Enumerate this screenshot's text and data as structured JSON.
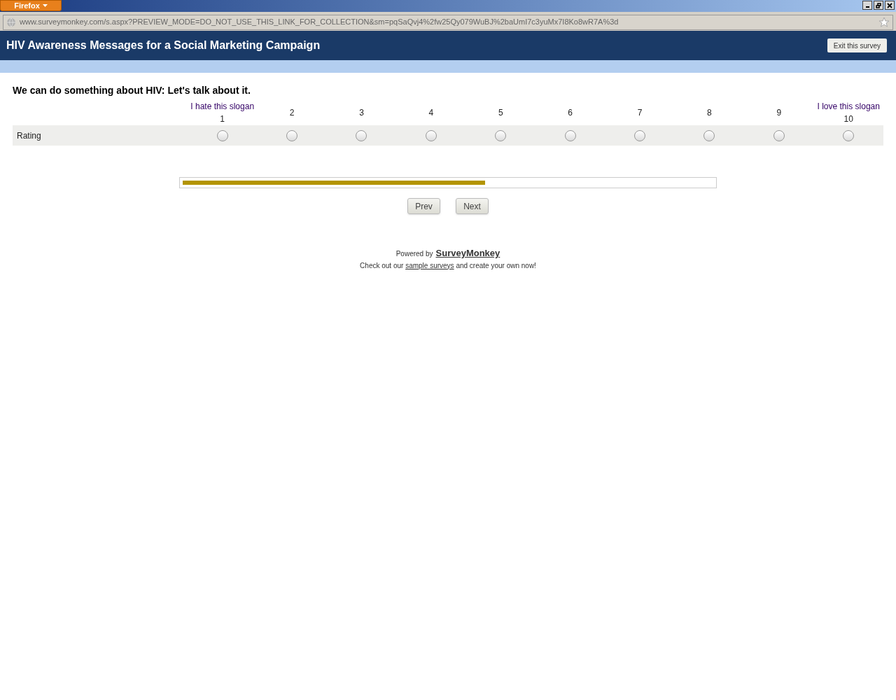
{
  "browser": {
    "menu_button": "Firefox",
    "url": "www.surveymonkey.com/s.aspx?PREVIEW_MODE=DO_NOT_USE_THIS_LINK_FOR_COLLECTION&sm=pqSaQvj4%2fw25Qy079WuBJ%2baUmI7c3yuMx7I8Ko8wR7A%3d"
  },
  "header": {
    "title": "HIV Awareness Messages for a Social Marketing Campaign",
    "exit_button": "Exit this survey"
  },
  "question": {
    "text": "We can do something about HIV: Let's talk about it.",
    "columns": [
      {
        "caption": "I hate this slogan",
        "number": "1"
      },
      {
        "number": "2"
      },
      {
        "number": "3"
      },
      {
        "number": "4"
      },
      {
        "number": "5"
      },
      {
        "number": "6"
      },
      {
        "number": "7"
      },
      {
        "number": "8"
      },
      {
        "number": "9"
      },
      {
        "caption": "I love this slogan",
        "number": "10"
      }
    ],
    "rows": [
      {
        "label": "Rating",
        "choices": [
          {
            "selected": false
          },
          {
            "selected": false
          },
          {
            "selected": false
          },
          {
            "selected": false
          },
          {
            "selected": false
          },
          {
            "selected": false
          },
          {
            "selected": false
          },
          {
            "selected": false
          },
          {
            "selected": false
          },
          {
            "selected": false
          }
        ]
      }
    ]
  },
  "progress": {
    "level": 0.57
  },
  "buttons": [
    "Prev",
    "Next"
  ],
  "footer": {
    "powered_by": "Powered by",
    "brand_link": "SurveyMonkey",
    "line_before": "Check out our",
    "line_link": "sample surveys",
    "line_after": "and create your own now!"
  }
}
